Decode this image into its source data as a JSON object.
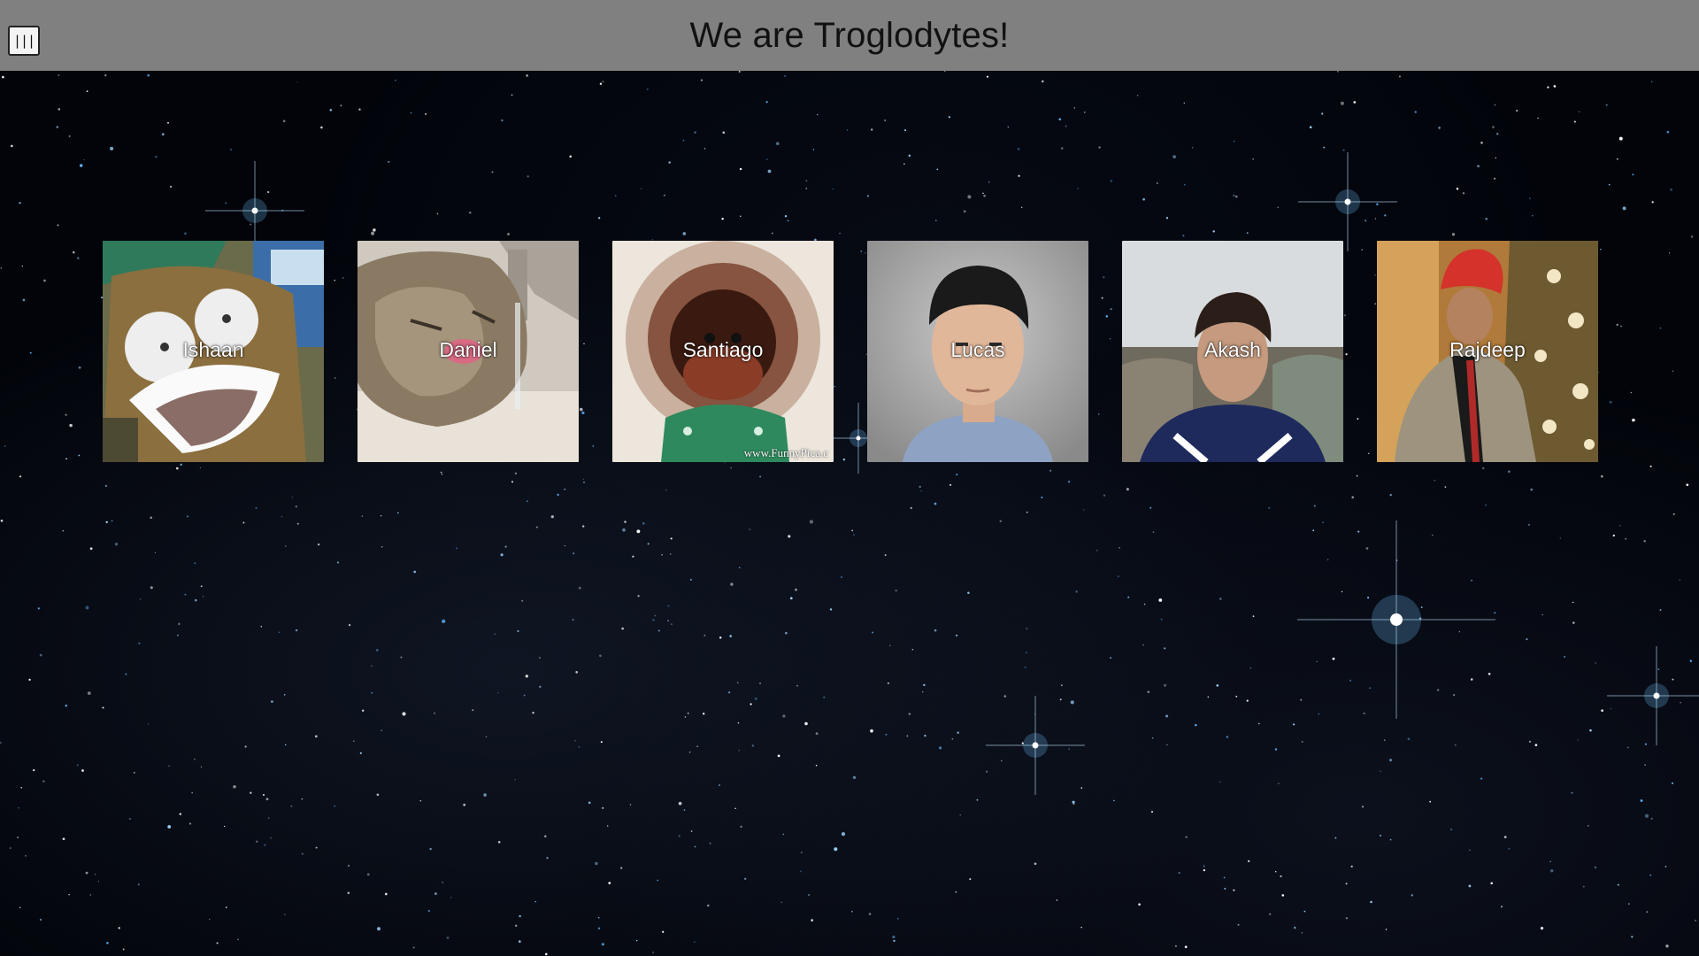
{
  "header": {
    "title": "We are Troglodytes!",
    "menu_icon": "|||",
    "background_color": "#808080"
  },
  "members": [
    {
      "name": "Ishaan",
      "image": "anime-shocked-face"
    },
    {
      "name": "Daniel",
      "image": "cat-drinking-tap-water"
    },
    {
      "name": "Santiago",
      "image": "fluffy-baby-orangutan",
      "watermark": "www.FunnyPica.c"
    },
    {
      "name": "Lucas",
      "image": "boy-portrait-grey-background"
    },
    {
      "name": "Akash",
      "image": "boy-selfie-rocky-shore"
    },
    {
      "name": "Rajdeep",
      "image": "boy-in-turban-christmas-tree"
    }
  ],
  "colors": {
    "page_background": "#02040a",
    "name_text": "#ffffff"
  }
}
